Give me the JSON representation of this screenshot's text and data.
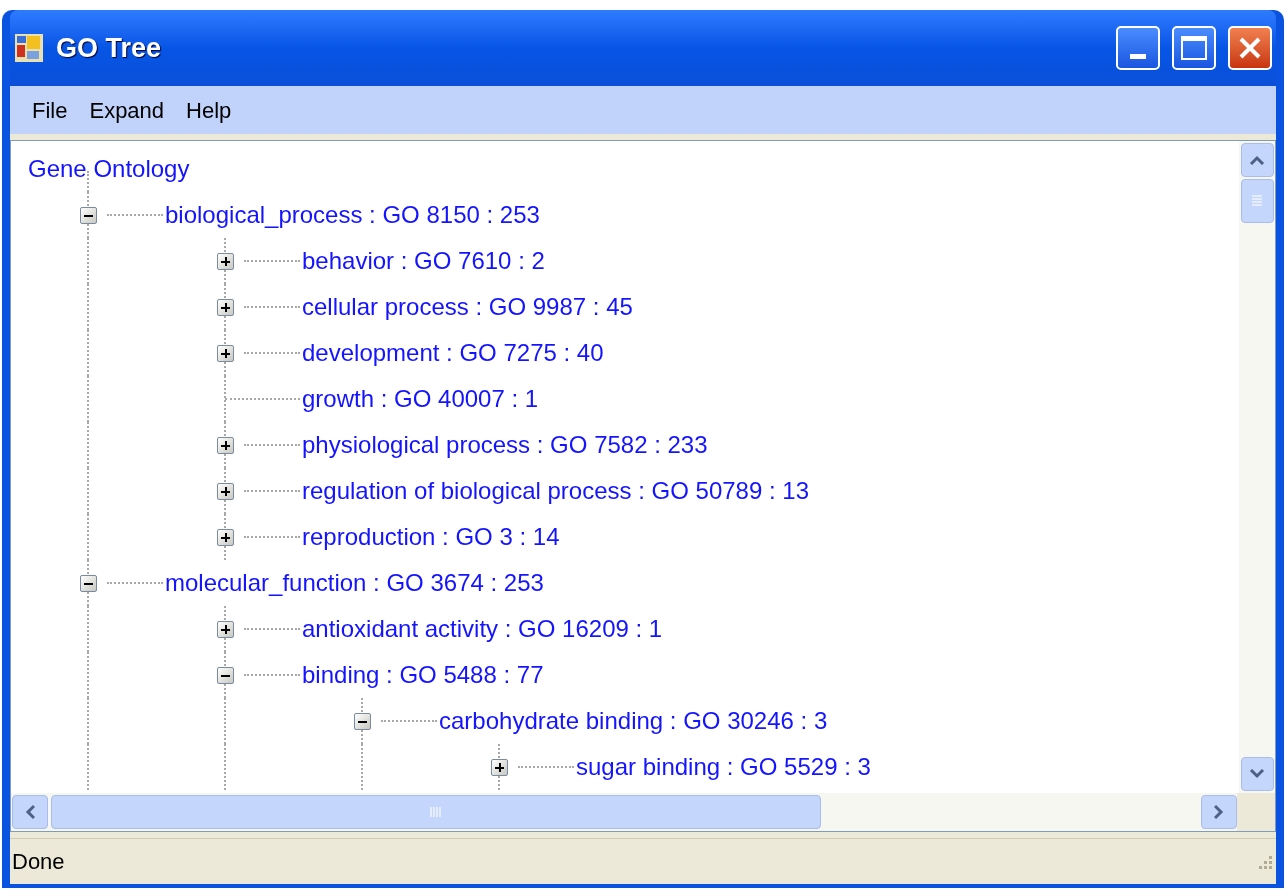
{
  "window": {
    "title": "GO Tree"
  },
  "menu": [
    "File",
    "Expand",
    "Help"
  ],
  "tree": {
    "label": "Gene Ontology",
    "children": [
      {
        "label": "biological_process : GO 8150 : 253",
        "expanded": true,
        "children": [
          {
            "label": "behavior : GO 7610 : 2",
            "expanded": false
          },
          {
            "label": "cellular process : GO 9987 : 45",
            "expanded": false
          },
          {
            "label": "development : GO 7275 : 40",
            "expanded": false
          },
          {
            "label": "growth : GO 40007 : 1",
            "kind": "leaf"
          },
          {
            "label": "physiological process : GO 7582 : 233",
            "expanded": false
          },
          {
            "label": "regulation of biological process : GO 50789 : 13",
            "expanded": false
          },
          {
            "label": "reproduction : GO 3 : 14",
            "expanded": false
          }
        ]
      },
      {
        "label": "molecular_function : GO 3674 : 253",
        "expanded": true,
        "children": [
          {
            "label": "antioxidant activity : GO 16209 : 1",
            "expanded": false
          },
          {
            "label": "binding : GO 5488 : 77",
            "expanded": true,
            "children": [
              {
                "label": "carbohydrate binding : GO 30246 : 3",
                "expanded": true,
                "children": [
                  {
                    "label": "sugar binding : GO 5529 : 3",
                    "expanded": false
                  }
                ]
              }
            ]
          }
        ]
      }
    ]
  },
  "status_bar": {
    "text": "Done"
  }
}
